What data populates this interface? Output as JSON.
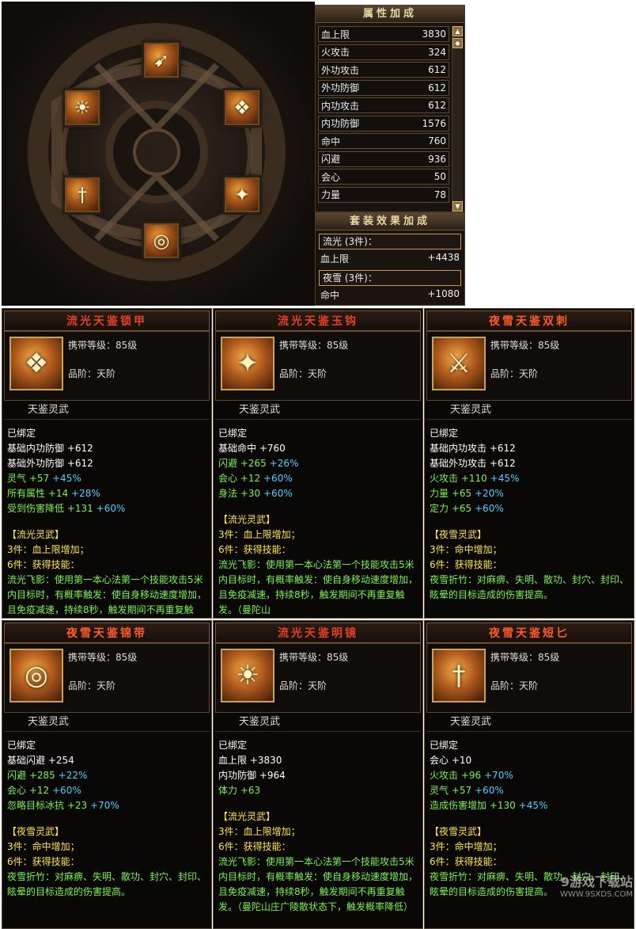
{
  "attr_panel": {
    "title": "属性加成",
    "rows": [
      {
        "k": "血上限",
        "v": "3830"
      },
      {
        "k": "火攻击",
        "v": "324"
      },
      {
        "k": "外功攻击",
        "v": "612"
      },
      {
        "k": "外功防御",
        "v": "612"
      },
      {
        "k": "内功攻击",
        "v": "612"
      },
      {
        "k": "内功防御",
        "v": "1576"
      },
      {
        "k": "命中",
        "v": "760"
      },
      {
        "k": "闪避",
        "v": "936"
      },
      {
        "k": "会心",
        "v": "50"
      },
      {
        "k": "力量",
        "v": "78"
      }
    ]
  },
  "set_panel": {
    "title": "套装效果加成",
    "sets": [
      {
        "name": "流光 (3件)：",
        "stat": "血上限",
        "value": "+4438"
      },
      {
        "name": "夜雪 (3件)：",
        "stat": "命中",
        "value": "+1080"
      }
    ]
  },
  "slots": {
    "top": "weapon-dagger-icon",
    "upper_left": "mirror-icon",
    "upper_right": "armor-icon",
    "lower_left": "short-blade-icon",
    "lower_right": "claw-icon",
    "bottom": "belt-icon"
  },
  "items": [
    {
      "title": "流光天鉴锁甲",
      "color": "lg",
      "icon": "armor-icon",
      "glyph": "❖",
      "level": "携带等级：85级",
      "grade": "品阶：天阶",
      "subtype": "天鉴灵武",
      "bound": "已绑定",
      "base": [
        {
          "t": "基础内功防御",
          "v": "+612",
          "x": ""
        },
        {
          "t": "基础外功防御",
          "v": "+612",
          "x": ""
        }
      ],
      "extra": [
        {
          "t": "灵气",
          "v": "+57",
          "x": "+45%"
        },
        {
          "t": "所有属性",
          "v": "+14",
          "x": "+28%"
        },
        {
          "t": "受到伤害降低",
          "v": "+131",
          "x": "+60%"
        }
      ],
      "set_name": "【流光灵武】",
      "set3": "3件：血上限增加；",
      "set6": "6件：获得技能：",
      "desc": "流光飞影：使用第一本心法第一个技能攻击5米内目标时，有概率触发：使自身移动速度增加，且免疫减速，持续8秒，触发期间不再重复触发。"
    },
    {
      "title": "流光天鉴玉钩",
      "color": "lg",
      "icon": "claw-icon",
      "glyph": "✦",
      "level": "携带等级：85级",
      "grade": "品阶：天阶",
      "subtype": "天鉴灵武",
      "bound": "已绑定",
      "base": [
        {
          "t": "基础命中",
          "v": "+760",
          "x": ""
        }
      ],
      "extra": [
        {
          "t": "闪避",
          "v": "+265",
          "x": "+26%"
        },
        {
          "t": "会心",
          "v": "+12",
          "x": "+60%"
        },
        {
          "t": "身法",
          "v": "+30",
          "x": "+60%"
        }
      ],
      "set_name": "【流光灵武】",
      "set3": "3件：血上限增加；",
      "set6": "6件：获得技能：",
      "desc": "流光飞影：使用第一本心法第一个技能攻击5米内目标时，有概率触发：使自身移动速度增加，且免疫减速，持续8秒，触发期间不再重复触发。（曼陀山"
    },
    {
      "title": "夜雪天鉴双刺",
      "color": "yx",
      "icon": "dual-dagger-icon",
      "glyph": "⚔",
      "level": "携带等级：85级",
      "grade": "品阶：天阶",
      "subtype": "天鉴灵武",
      "bound": "已绑定",
      "base": [
        {
          "t": "基础内功攻击",
          "v": "+612",
          "x": ""
        },
        {
          "t": "基础外功攻击",
          "v": "+612",
          "x": ""
        }
      ],
      "extra": [
        {
          "t": "火攻击",
          "v": "+110",
          "x": "+45%"
        },
        {
          "t": "力量",
          "v": "+65",
          "x": "+20%"
        },
        {
          "t": "定力",
          "v": "+65",
          "x": "+60%"
        }
      ],
      "set_name": "【夜雪灵武】",
      "set3": "3件：命中增加；",
      "set6": "6件：获得技能：",
      "desc": "夜雪折竹：对麻痹、失明、散功、封穴、封印、眩晕的目标造成的伤害提高。"
    },
    {
      "title": "夜雪天鉴锦带",
      "color": "yx",
      "icon": "belt-icon",
      "glyph": "◎",
      "level": "携带等级：85级",
      "grade": "品阶：天阶",
      "subtype": "天鉴灵武",
      "bound": "已绑定",
      "base": [
        {
          "t": "基础闪避",
          "v": "+254",
          "x": ""
        }
      ],
      "extra": [
        {
          "t": "闪避",
          "v": "+285",
          "x": "+22%"
        },
        {
          "t": "会心",
          "v": "+12",
          "x": "+60%"
        },
        {
          "t": "忽略目标冰抗",
          "v": "+23",
          "x": "+70%"
        }
      ],
      "set_name": "【夜雪灵武】",
      "set3": "3件：命中增加；",
      "set6": "6件：获得技能：",
      "desc": "夜雪折竹：对麻痹、失明、散功、封穴、封印、眩晕的目标造成的伤害提高。"
    },
    {
      "title": "流光天鉴明镜",
      "color": "lg",
      "icon": "mirror-icon",
      "glyph": "☀",
      "level": "携带等级：85级",
      "grade": "品阶：天阶",
      "subtype": "天鉴灵武",
      "bound": "已绑定",
      "base": [
        {
          "t": "血上限",
          "v": "+3830",
          "x": ""
        },
        {
          "t": "内功防御",
          "v": "+964",
          "x": ""
        }
      ],
      "extra": [
        {
          "t": "体力",
          "v": "+63",
          "x": ""
        }
      ],
      "set_name": "【流光灵武】",
      "set3": "3件：血上限增加；",
      "set6": "6件：获得技能：",
      "desc": "流光飞影：使用第一本心法第一个技能攻击5米内目标时，有概率触发：使自身移动速度增加，且免疫减速，持续8秒，触发期间不再重复触发。（曼陀山庄广陵散状态下，触发概率降低）"
    },
    {
      "title": "夜雪天鉴短匕",
      "color": "yx",
      "icon": "short-blade-icon",
      "glyph": "†",
      "level": "携带等级：85级",
      "grade": "品阶：天阶",
      "subtype": "天鉴灵武",
      "bound": "已绑定",
      "base": [
        {
          "t": "会心",
          "v": "+10",
          "x": ""
        }
      ],
      "extra": [
        {
          "t": "火攻击",
          "v": "+96",
          "x": "+70%"
        },
        {
          "t": "灵气",
          "v": "+57",
          "x": "+60%"
        },
        {
          "t": "造成伤害增加",
          "v": "+130",
          "x": "+45%"
        }
      ],
      "set_name": "【夜雪灵武】",
      "set3": "3件：命中增加；",
      "set6": "6件：获得技能：",
      "desc": "夜雪折竹：对麻痹、失明、散功、封穴、封印、眩晕的目标造成的伤害提高。"
    }
  ],
  "watermark": {
    "text": "9游戏下载站",
    "url": "WWW.9SXDS.COM"
  }
}
